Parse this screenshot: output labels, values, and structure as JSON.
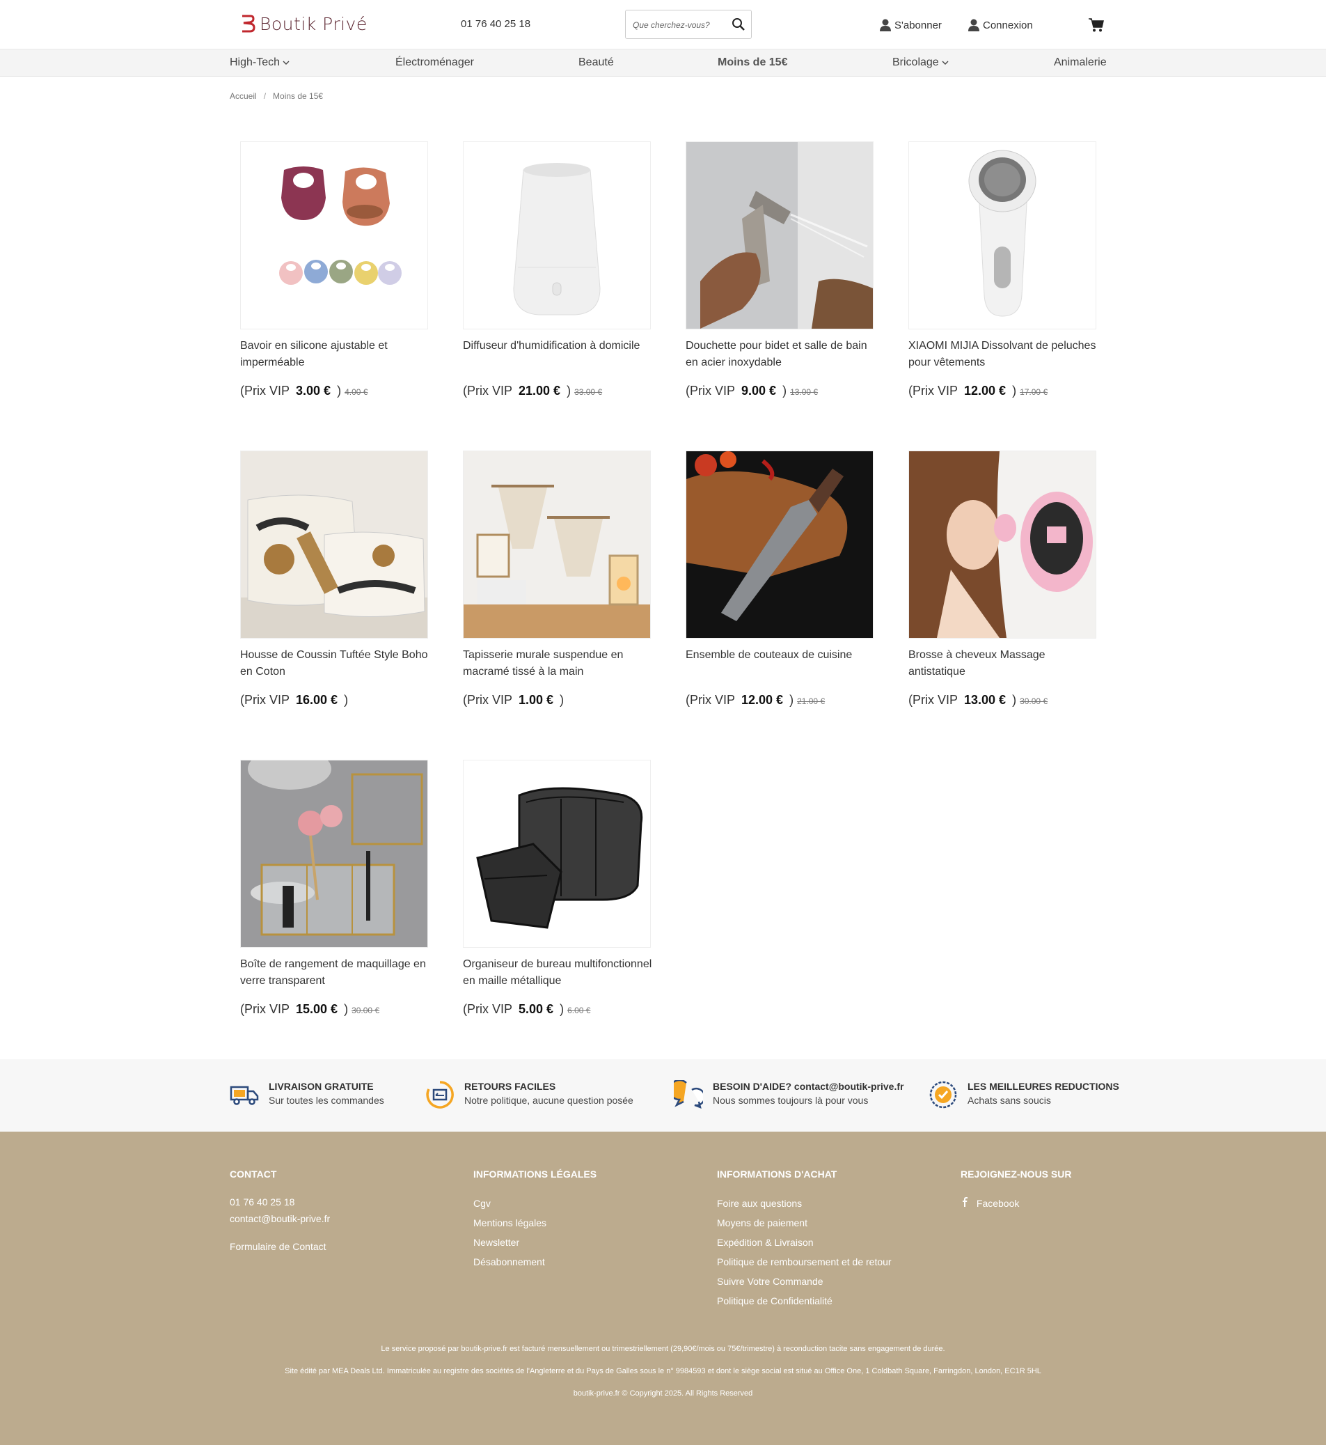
{
  "header": {
    "logo_text": "Boutik Privé",
    "phone": "01 76 40 25 18",
    "search_placeholder": "Que cherchez-vous?",
    "subscribe": "S'abonner",
    "login": "Connexion"
  },
  "nav": {
    "items": [
      {
        "label": "High-Tech",
        "dropdown": true
      },
      {
        "label": "Électroménager",
        "dropdown": false
      },
      {
        "label": "Beauté",
        "dropdown": false
      },
      {
        "label": "Moins de 15€",
        "dropdown": false,
        "active": true
      },
      {
        "label": "Bricolage",
        "dropdown": true
      },
      {
        "label": "Animalerie",
        "dropdown": false
      }
    ]
  },
  "breadcrumb": {
    "home": "Accueil",
    "sep": "/",
    "current": "Moins de 15€"
  },
  "price_prefix": "(Prix VIP",
  "price_suffix": ")",
  "products": [
    {
      "title": "Bavoir en silicone ajustable et imperméable",
      "price": "3.00 €",
      "old_price": "4.00 €",
      "icon": "silicone-bibs"
    },
    {
      "title": "Diffuseur d'humidification à domicile",
      "price": "21.00 €",
      "old_price": "33.00 €",
      "icon": "humidifier"
    },
    {
      "title": "Douchette pour bidet et salle de bain en acier inoxydable",
      "price": "9.00 €",
      "old_price": "13.00 €",
      "icon": "bidet-sprayer"
    },
    {
      "title": "XIAOMI MIJIA Dissolvant de peluches pour vêtements",
      "price": "12.00 €",
      "old_price": "17.00 €",
      "icon": "lint-remover"
    },
    {
      "title": "Housse de Coussin Tuftée Style Boho en Coton",
      "price": "16.00 €",
      "old_price": "",
      "icon": "cushion-cover"
    },
    {
      "title": "Tapisserie murale suspendue en macramé tissé à la main",
      "price": "1.00 €",
      "old_price": "",
      "icon": "macrame"
    },
    {
      "title": "Ensemble de couteaux de cuisine",
      "price": "12.00 €",
      "old_price": "21.00 €",
      "icon": "kitchen-knife"
    },
    {
      "title": "Brosse à cheveux Massage antistatique",
      "price": "13.00 €",
      "old_price": "30.00 €",
      "icon": "hair-brush"
    },
    {
      "title": "Boîte de rangement de maquillage en verre transparent",
      "price": "15.00 €",
      "old_price": "30.00 €",
      "icon": "makeup-organizer"
    },
    {
      "title": "Organiseur de bureau multifonctionnel en maille métallique",
      "price": "5.00 €",
      "old_price": "6.00 €",
      "icon": "desk-organizer"
    }
  ],
  "benefits": [
    {
      "title": "LIVRAISON GRATUITE",
      "subtitle": "Sur toutes les commandes",
      "icon": "truck-icon"
    },
    {
      "title": "RETOURS FACILES",
      "subtitle": "Notre politique, aucune question posée",
      "icon": "return-icon"
    },
    {
      "title_prefix": "BESOIN D'AIDE?",
      "title_email": "contact@boutik-prive.fr",
      "subtitle": "Nous sommes toujours là pour vous",
      "icon": "chat-icon"
    },
    {
      "title": "LES MEILLEURES REDUCTIONS",
      "subtitle": "Achats sans soucis",
      "icon": "badge-icon"
    }
  ],
  "footer": {
    "contact": {
      "heading": "CONTACT",
      "phone": "01 76 40 25 18",
      "email": "contact@boutik-prive.fr",
      "form": "Formulaire de Contact"
    },
    "legal": {
      "heading": "INFORMATIONS LÉGALES",
      "links": [
        "Cgv",
        "Mentions légales",
        "Newsletter",
        "Désabonnement"
      ]
    },
    "purchase": {
      "heading": "INFORMATIONS D'ACHAT",
      "links": [
        "Foire aux questions",
        "Moyens de paiement",
        "Expédition & Livraison",
        "Politique de remboursement et de retour",
        "Suivre Votre Commande",
        "Politique de Confidentialité"
      ]
    },
    "social": {
      "heading": "REJOIGNEZ-NOUS SUR",
      "facebook": "Facebook"
    },
    "notice1": "Le service proposé par boutik-prive.fr est facturé mensuellement ou trimestriellement (29,90€/mois ou 75€/trimestre) à reconduction tacite sans engagement de durée.",
    "notice2": "Site édité par MEA Deals Ltd.  Immatriculée au registre des sociétés de l'Angleterre et du Pays de Galles sous le n° 9984593 et dont le siège social est situé au Office One, 1 Coldbath Square, Farringdon, London, EC1R 5HL",
    "copyright": "boutik-prive.fr © Copyright 2025. All Rights Reserved"
  },
  "colors": {
    "footer_bg": "#bcab8e",
    "logo": "#c0272d",
    "accent_orange": "#f5a623",
    "benefit_blue": "#2c4a7c"
  }
}
